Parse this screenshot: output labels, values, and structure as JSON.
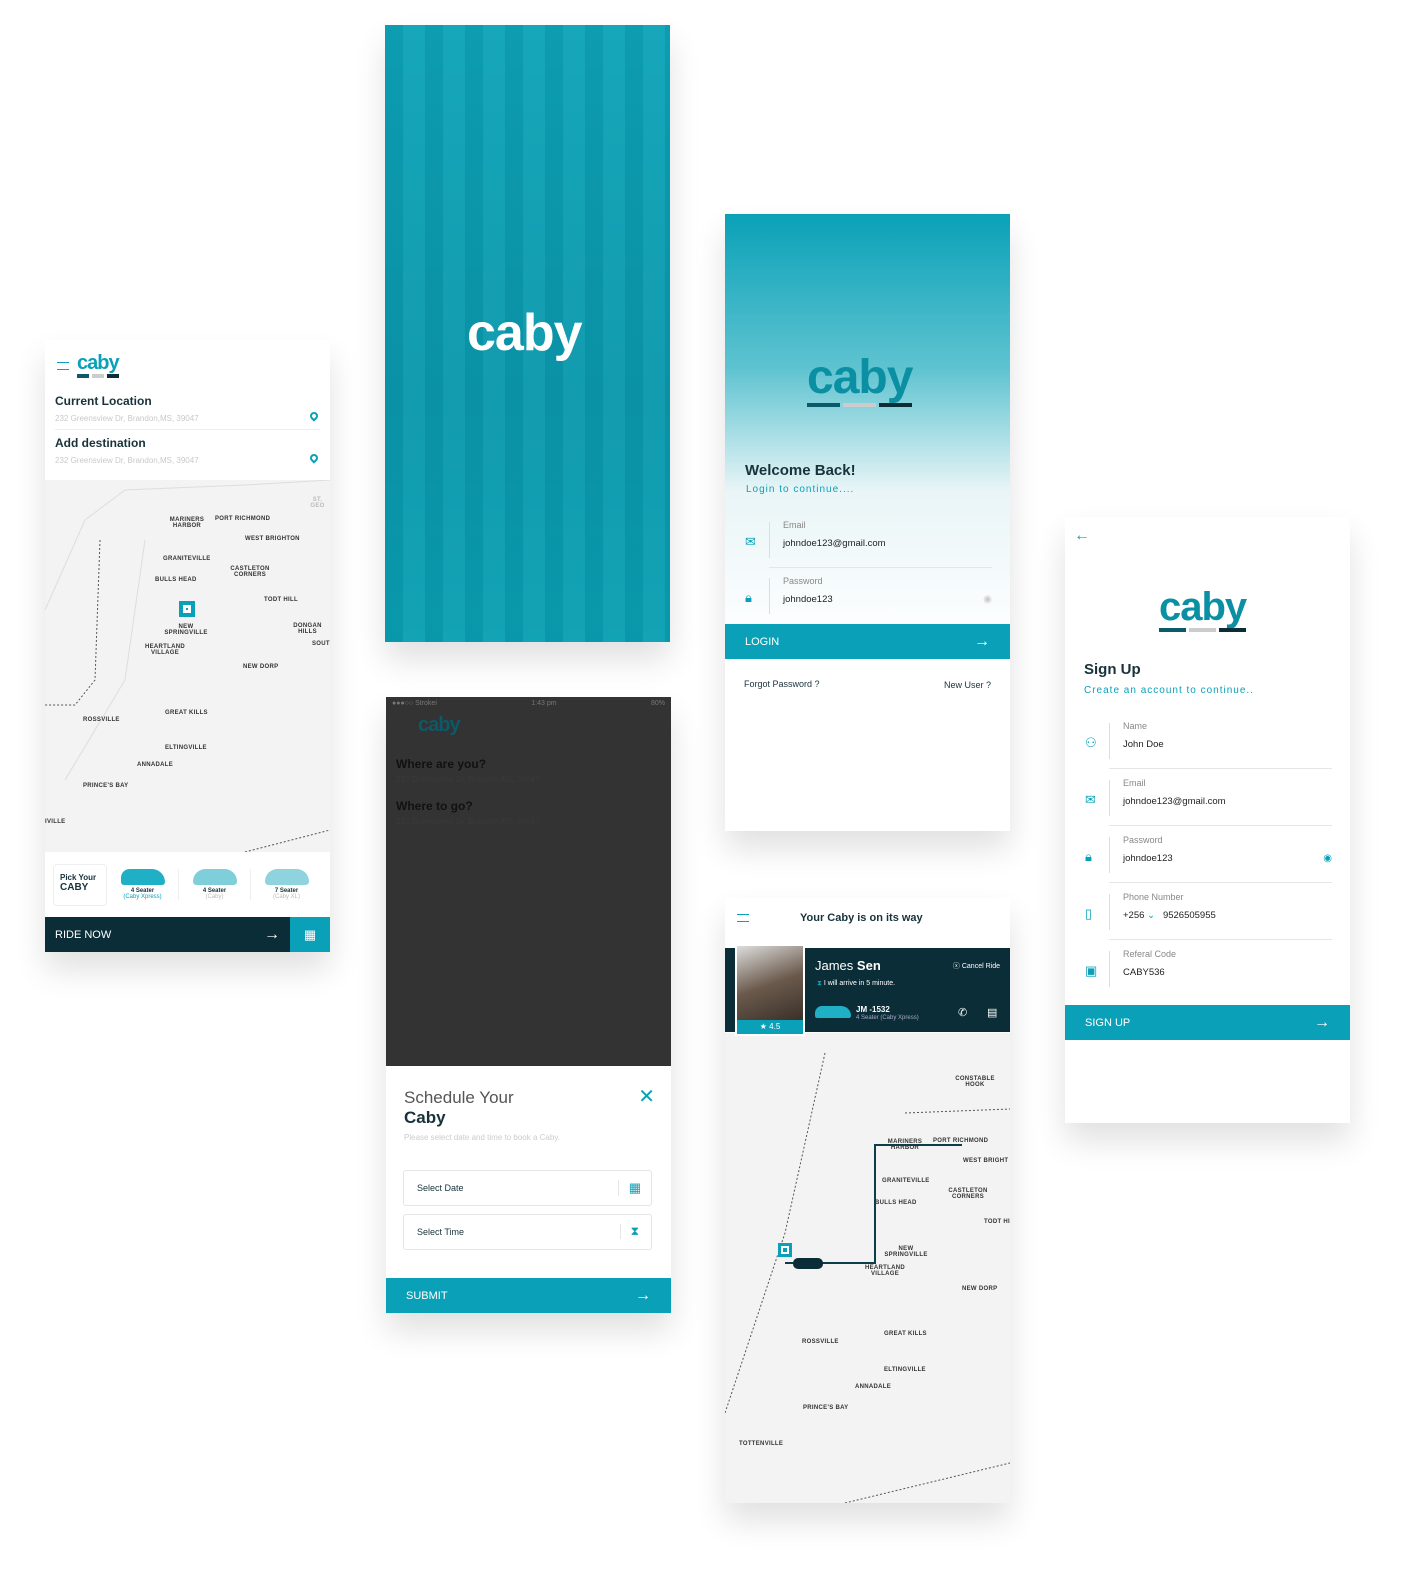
{
  "brand": {
    "logo": "caby",
    "accent": "#0aa1b8",
    "dark": "#0b2d37"
  },
  "home": {
    "current_label": "Current Location",
    "current_addr": "232 Greensview Dr, Brandon,MS, 39047",
    "dest_label": "Add destination",
    "dest_addr": "232 Greensview Dr, Brandon,MS, 39047",
    "map_labels": [
      "MARINERS HARBOR",
      "PORT RICHMOND",
      "WEST BRIGHTON",
      "GRANITEVILLE",
      "CASTLETON CORNERS",
      "BULLS HEAD",
      "TODT HILL",
      "NEW SPRINGVILLE",
      "DONGAN HILLS",
      "HEARTLAND VILLAGE",
      "SOUT",
      "NEW DORP",
      "GREAT KILLS",
      "ROSSVILLE",
      "ELTINGVILLE",
      "ANNADALE",
      "PRINCE'S BAY",
      "IVILLE",
      "ST. GEO"
    ],
    "pick_line1": "Pick Your",
    "pick_line2": "CABY",
    "cars": [
      {
        "seats": "4 Seater",
        "type": "(Caby Xpress)"
      },
      {
        "seats": "4 Seater",
        "type": "(Caby)"
      },
      {
        "seats": "7 Seater",
        "type": "(Caby XL)"
      }
    ],
    "ride_now": "RIDE NOW"
  },
  "dark": {
    "carrier": "●●●○○ Strokei",
    "time": "1:43 pm",
    "battery": "80%",
    "where_are_you": "Where are you?",
    "where_to_go": "Where to go?",
    "addr": "232 Greensview Dr, Brandon,MS, 39047"
  },
  "schedule": {
    "title_light": "Schedule Your",
    "title_bold": "Caby",
    "subtitle": "Please select date and time to book a Caby.",
    "date_placeholder": "Select Date",
    "time_placeholder": "Select Time",
    "submit": "SUBMIT"
  },
  "login": {
    "title": "Welcome Back!",
    "subtitle": "Login to continue....",
    "email_label": "Email",
    "email_value": "johndoe123@gmail.com",
    "password_label": "Password",
    "password_value": "johndoe123",
    "login": "LOGIN",
    "forgot": "Forgot Password ?",
    "new_user": "New User ?"
  },
  "tracking": {
    "title": "Your Caby is on its way",
    "driver_first": "James",
    "driver_last": "Sen",
    "cancel": "Cancel Ride",
    "eta": "I will arrive in 5 minute.",
    "rating": "4.5",
    "plate": "JM -1532",
    "car_type": "4 Seater (Caby Xpress)",
    "map_labels": [
      "CONSTABLE HOOK",
      "MARINERS HARBOR",
      "PORT RICHMOND",
      "WEST BRIGHT",
      "GRANITEVILLE",
      "CASTLETON CORNERS",
      "BULLS HEAD",
      "TODT HI",
      "NEW SPRINGVILLE",
      "HEARTLAND VILLAGE",
      "NEW DORP",
      "GREAT KILLS",
      "ROSSVILLE",
      "ELTINGVILLE",
      "ANNADALE",
      "PRINCE'S BAY",
      "TOTTENVILLE"
    ]
  },
  "signup": {
    "title": "Sign Up",
    "subtitle": "Create an account to continue..",
    "name_label": "Name",
    "name_value": "John Doe",
    "email_label": "Email",
    "email_value": "johndoe123@gmail.com",
    "password_label": "Password",
    "password_value": "johndoe123",
    "phone_label": "Phone Number",
    "phone_code": "+256",
    "phone_value": "9526505955",
    "referral_label": "Referal Code",
    "referral_value": "CABY536",
    "submit": "SIGN UP"
  }
}
